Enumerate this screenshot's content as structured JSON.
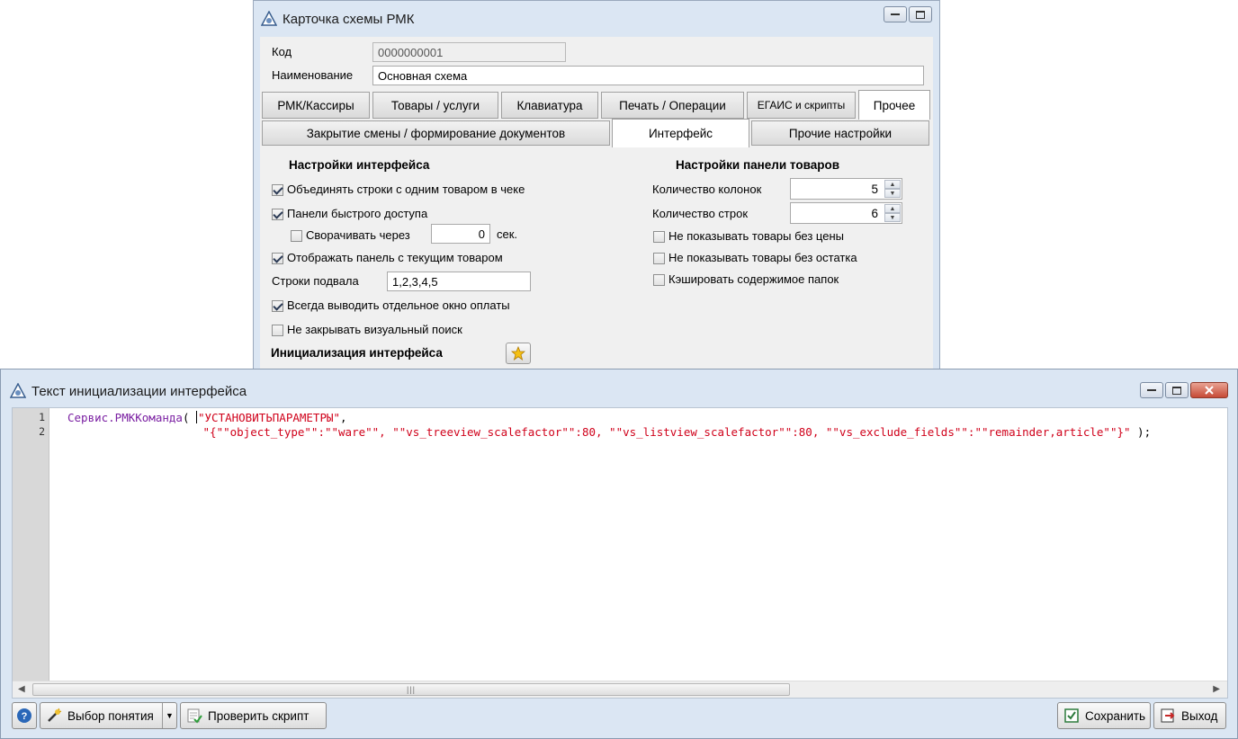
{
  "card_window": {
    "title": "Карточка схемы РМК",
    "code_label": "Код",
    "code_value": "0000000001",
    "name_label": "Наименование",
    "name_value": "Основная схема",
    "tabs_row1": [
      "РМК/Кассиры",
      "Товары / услуги",
      "Клавиатура",
      "Печать / Операции",
      "ЕГАИС и скрипты",
      "Прочее"
    ],
    "tabs_row2": [
      "Закрытие смены / формирование документов",
      "Интерфейс",
      "Прочие настройки"
    ],
    "interface_settings": {
      "title": "Настройки интерфейса",
      "merge_rows": {
        "label": "Объединять строки с одним товаром в чеке",
        "checked": true
      },
      "quick_panels": {
        "label": "Панели быстрого доступа",
        "checked": true
      },
      "collapse_after": {
        "label": "Сворачивать через",
        "checked": false,
        "value": "0",
        "unit": "сек."
      },
      "show_current_panel": {
        "label": "Отображать панель с текущим товаром",
        "checked": true
      },
      "footer_rows_label": "Строки подвала",
      "footer_rows_value": "1,2,3,4,5",
      "always_payment_window": {
        "label": "Всегда выводить отдельное окно оплаты",
        "checked": true
      },
      "keep_visual_search": {
        "label": "Не закрывать визуальный поиск",
        "checked": false
      },
      "init_label": "Инициализация интерфейса"
    },
    "goods_panel": {
      "title": "Настройки панели товаров",
      "columns_label": "Количество колонок",
      "columns_value": "5",
      "rows_label": "Количество строк",
      "rows_value": "6",
      "hide_no_price": {
        "label": "Не показывать товары без цены",
        "checked": false
      },
      "hide_no_stock": {
        "label": "Не показывать товары без остатка",
        "checked": false
      },
      "cache_folders": {
        "label": "Кэшировать содержимое папок",
        "checked": false
      }
    }
  },
  "init_window": {
    "title": "Текст инициализации интерфейса",
    "line_numbers": [
      "1",
      "2"
    ],
    "code": {
      "l1_object": "Сервис.РМККоманда",
      "l1_open": "( ",
      "l1_string": "\"УСТАНОВИТЬПАРАМЕТРЫ\"",
      "l1_comma": ",",
      "l2_indent": "                    ",
      "l2_string": "\"{\"\"object_type\"\":\"\"ware\"\", \"\"vs_treeview_scalefactor\"\":80, \"\"vs_listview_scalefactor\"\":80, \"\"vs_exclude_fields\"\":\"\"remainder,article\"\"}\"",
      "l2_close": " );"
    },
    "buttons": {
      "help": "?",
      "choose": "Выбор понятия",
      "check": "Проверить скрипт",
      "save": "Сохранить",
      "exit": "Выход"
    }
  },
  "colors": {
    "keyword": "#7a1fa2",
    "string": "#d0021b",
    "titlebar": "#dbe6f3"
  }
}
